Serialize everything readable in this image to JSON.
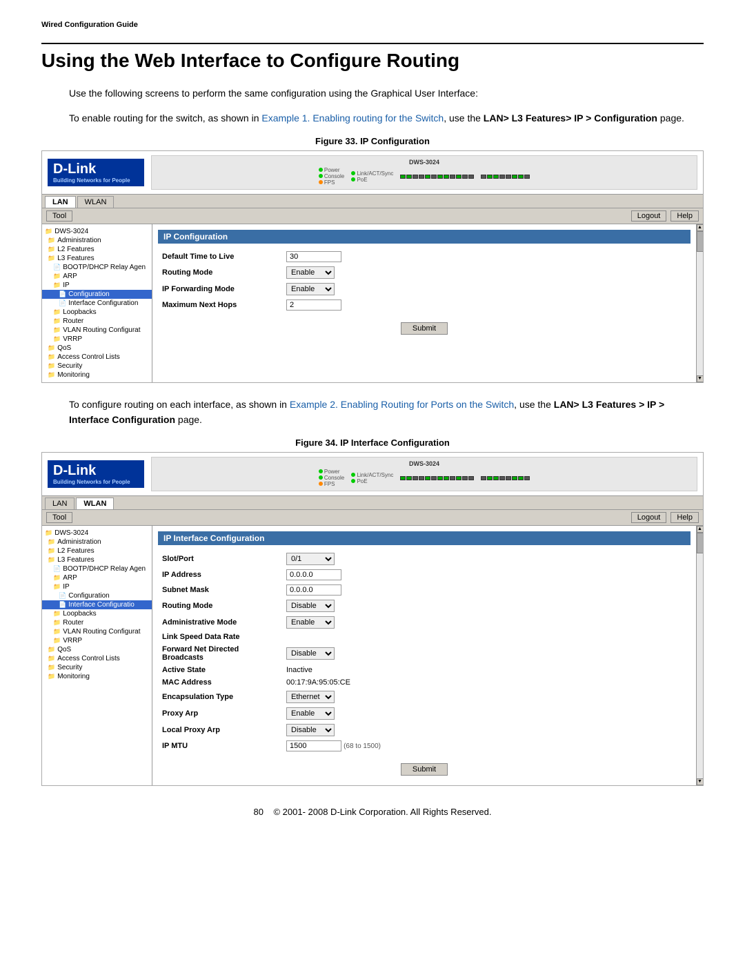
{
  "header": {
    "label": "Wired Configuration Guide"
  },
  "page": {
    "title": "Using the Web Interface to Configure Routing",
    "intro_text": "Use the following screens to perform the same configuration using the Graphical User Interface:",
    "para1_pre": "To enable routing for the switch, as shown in ",
    "para1_link": "Example 1. Enabling routing for the Switch",
    "para1_post": ", use the ",
    "para1_bold": "LAN> L3 Features> IP > Configuration",
    "para1_page": " page.",
    "fig33_caption": "Figure 33. IP Configuration",
    "para2_pre": "To configure routing on each interface, as shown in ",
    "para2_link": "Example 2. Enabling Routing for Ports on the Switch",
    "para2_post": ", use the ",
    "para2_bold": "LAN> L3 Features > IP > Interface Configuration",
    "para2_page": " page.",
    "fig34_caption": "Figure 34. IP Interface Configuration"
  },
  "fig33": {
    "device_name": "DWS-3024",
    "tabs": [
      "LAN",
      "WLAN"
    ],
    "active_tab": "LAN",
    "toolbar_left": "Tool",
    "toolbar_right1": "Logout",
    "toolbar_right2": "Help",
    "section_title": "IP Configuration",
    "fields": [
      {
        "label": "Default Time to Live",
        "value": "30",
        "type": "input"
      },
      {
        "label": "Routing Mode",
        "value": "Enable",
        "type": "select"
      },
      {
        "label": "IP Forwarding Mode",
        "value": "Enable",
        "type": "select"
      },
      {
        "label": "Maximum Next Hops",
        "value": "2",
        "type": "input"
      }
    ],
    "submit_label": "Submit",
    "sidebar_items": [
      {
        "label": "DWS-3024",
        "indent": 0
      },
      {
        "label": "Administration",
        "indent": 1
      },
      {
        "label": "L2 Features",
        "indent": 1
      },
      {
        "label": "L3 Features",
        "indent": 1
      },
      {
        "label": "BOOTP/DHCP Relay Agen",
        "indent": 2
      },
      {
        "label": "ARP",
        "indent": 2
      },
      {
        "label": "IP",
        "indent": 2
      },
      {
        "label": "Configuration",
        "indent": 3,
        "selected": true
      },
      {
        "label": "Interface Configuration",
        "indent": 3
      },
      {
        "label": "Loopbacks",
        "indent": 2
      },
      {
        "label": "Router",
        "indent": 2
      },
      {
        "label": "VLAN Routing Configurat",
        "indent": 2
      },
      {
        "label": "VRRP",
        "indent": 2
      },
      {
        "label": "QoS",
        "indent": 1
      },
      {
        "label": "Access Control Lists",
        "indent": 1
      },
      {
        "label": "Security",
        "indent": 1
      },
      {
        "label": "Monitoring",
        "indent": 1
      }
    ]
  },
  "fig34": {
    "device_name": "DWS-3024",
    "tabs": [
      "LAN",
      "WLAN"
    ],
    "active_tab": "WLAN",
    "toolbar_left": "Tool",
    "toolbar_right1": "Logout",
    "toolbar_right2": "Help",
    "section_title": "IP Interface Configuration",
    "fields": [
      {
        "label": "Slot/Port",
        "value": "0/1",
        "type": "select"
      },
      {
        "label": "IP Address",
        "value": "0.0.0.0",
        "type": "input"
      },
      {
        "label": "Subnet Mask",
        "value": "0.0.0.0",
        "type": "input"
      },
      {
        "label": "Routing Mode",
        "value": "Disable",
        "type": "select"
      },
      {
        "label": "Administrative Mode",
        "value": "Enable",
        "type": "select"
      },
      {
        "label": "Link Speed Data Rate",
        "value": "",
        "type": "text"
      },
      {
        "label": "Forward Net Directed Broadcasts",
        "value": "Disable",
        "type": "select"
      },
      {
        "label": "Active State",
        "value": "Inactive",
        "type": "text"
      },
      {
        "label": "MAC Address",
        "value": "00:17:9A:95:05:CE",
        "type": "text"
      },
      {
        "label": "Encapsulation Type",
        "value": "Ethernet",
        "type": "select"
      },
      {
        "label": "Proxy Arp",
        "value": "Enable",
        "type": "select"
      },
      {
        "label": "Local Proxy Arp",
        "value": "Disable",
        "type": "select"
      },
      {
        "label": "IP MTU",
        "value": "1500",
        "type": "input",
        "note": "(68 to 1500)"
      }
    ],
    "submit_label": "Submit",
    "sidebar_items": [
      {
        "label": "DWS-3024",
        "indent": 0
      },
      {
        "label": "Administration",
        "indent": 1
      },
      {
        "label": "L2 Features",
        "indent": 1
      },
      {
        "label": "L3 Features",
        "indent": 1
      },
      {
        "label": "BOOTP/DHCP Relay Agen",
        "indent": 2
      },
      {
        "label": "ARP",
        "indent": 2
      },
      {
        "label": "IP",
        "indent": 2
      },
      {
        "label": "Configuration",
        "indent": 3
      },
      {
        "label": "Interface Configuratio",
        "indent": 3,
        "selected": true
      },
      {
        "label": "Loopbacks",
        "indent": 2
      },
      {
        "label": "Router",
        "indent": 2
      },
      {
        "label": "VLAN Routing Configurat",
        "indent": 2
      },
      {
        "label": "VRRP",
        "indent": 2
      },
      {
        "label": "QoS",
        "indent": 1
      },
      {
        "label": "Access Control Lists",
        "indent": 1
      },
      {
        "label": "Security",
        "indent": 1
      },
      {
        "label": "Monitoring",
        "indent": 1
      }
    ]
  },
  "footer": {
    "page_number": "80",
    "copyright": "© 2001- 2008 D-Link Corporation. All Rights Reserved."
  }
}
